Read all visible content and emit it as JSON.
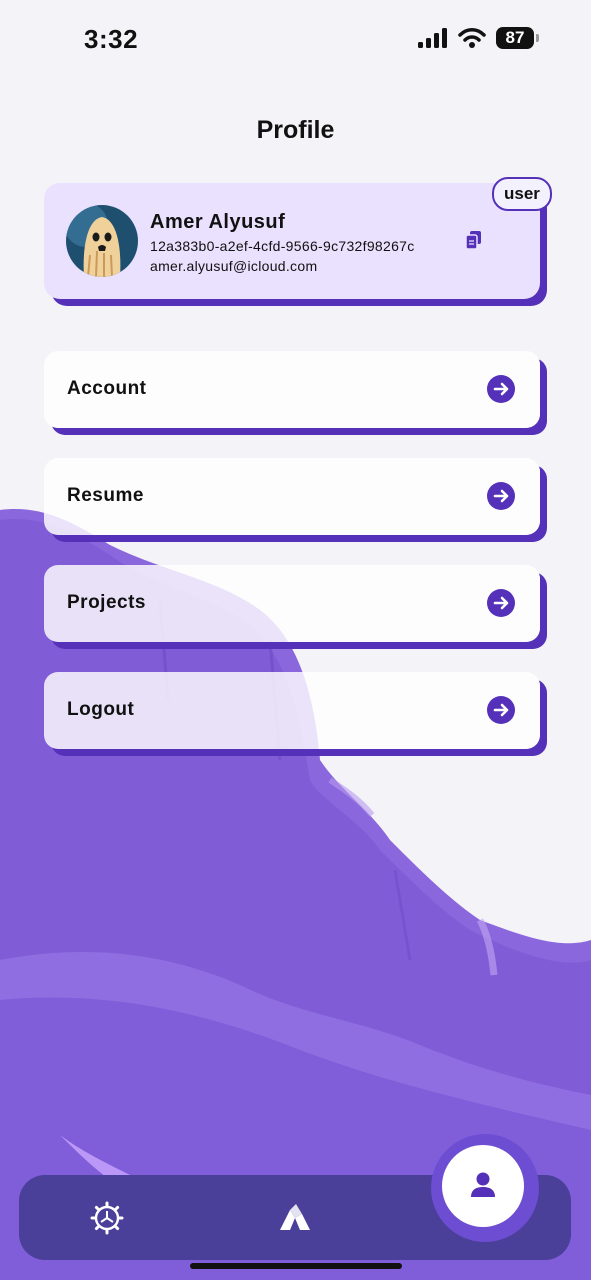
{
  "status_bar": {
    "time": "3:32",
    "battery": "87",
    "icons": [
      "signal-icon",
      "wifi-icon",
      "battery-icon"
    ]
  },
  "page": {
    "title": "Profile"
  },
  "profile": {
    "name": "Amer Alyusuf",
    "user_id": "12a383b0-a2ef-4cfd-9566-9c732f98267c",
    "email": "amer.alyusuf@icloud.com",
    "role": "user",
    "avatar_icon": "ghost-avatar",
    "copy_icon": "copy-icon"
  },
  "menu": {
    "items": [
      {
        "label": "Account",
        "icon": "arrow-right-circle-icon"
      },
      {
        "label": "Resume",
        "icon": "arrow-right-circle-icon"
      },
      {
        "label": "Projects",
        "icon": "arrow-right-circle-icon"
      },
      {
        "label": "Logout",
        "icon": "arrow-right-circle-icon"
      }
    ]
  },
  "tab_bar": {
    "tabs": [
      {
        "icon": "settings-icon"
      },
      {
        "icon": "projects-icon"
      },
      {
        "icon": "profile-icon",
        "active": true
      }
    ]
  },
  "colors": {
    "accent": "#5431b8",
    "card_background": "#e9e1fd",
    "tab_bar": "#4a3f99",
    "background": "#f4f3f7"
  }
}
